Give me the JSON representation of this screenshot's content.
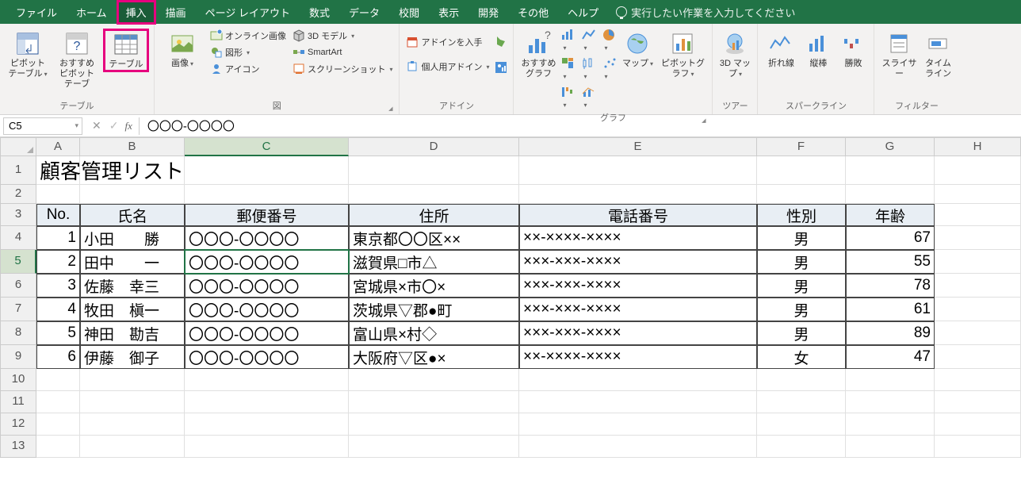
{
  "tabs": [
    "ファイル",
    "ホーム",
    "挿入",
    "描画",
    "ページ レイアウト",
    "数式",
    "データ",
    "校閲",
    "表示",
    "開発",
    "その他",
    "ヘルプ"
  ],
  "tellme": "実行したい作業を入力してください",
  "ribbon": {
    "g_tables": {
      "label": "テーブル",
      "pivot": "ピボット\nテーブル",
      "recpivot": "おすすめ\nピボットテーブ",
      "table": "テーブル"
    },
    "g_illust": {
      "label": "図",
      "image": "画像",
      "online": "オンライン画像",
      "shapes": "図形",
      "icons": "アイコン",
      "model": "3D モデル",
      "smartart": "SmartArt",
      "screenshot": "スクリーンショット"
    },
    "g_addins": {
      "label": "アドイン",
      "get": "アドインを入手",
      "my": "個人用アドイン"
    },
    "g_charts": {
      "label": "グラフ",
      "rec": "おすすめ\nグラフ",
      "map": "マップ",
      "pivotchart": "ピボットグラフ"
    },
    "g_tours": {
      "label": "ツアー",
      "map3d": "3D\nマップ"
    },
    "g_spark": {
      "label": "スパークライン",
      "line": "折れ線",
      "col": "縦棒",
      "winloss": "勝敗"
    },
    "g_filter": {
      "label": "フィルター",
      "slicer": "スライサー",
      "timeline": "タイム\nライン"
    }
  },
  "fbar": {
    "name": "C5",
    "formula": "〇〇〇-〇〇〇〇"
  },
  "cols": [
    "A",
    "B",
    "C",
    "D",
    "E",
    "F",
    "G",
    "H"
  ],
  "title": "顧客管理リスト",
  "headers": [
    "No.",
    "氏名",
    "郵便番号",
    "住所",
    "電話番号",
    "性別",
    "年齢"
  ],
  "data": [
    {
      "no": "1",
      "name": "小田　　勝",
      "zip": "〇〇〇-〇〇〇〇",
      "addr": "東京都〇〇区××",
      "tel": "××-××××-××××",
      "sex": "男",
      "age": "67"
    },
    {
      "no": "2",
      "name": "田中　　一",
      "zip": "〇〇〇-〇〇〇〇",
      "addr": "滋賀県□市△",
      "tel": "×××-×××-××××",
      "sex": "男",
      "age": "55"
    },
    {
      "no": "3",
      "name": "佐藤　幸三",
      "zip": "〇〇〇-〇〇〇〇",
      "addr": "宮城県×市〇×",
      "tel": "×××-×××-××××",
      "sex": "男",
      "age": "78"
    },
    {
      "no": "4",
      "name": "牧田　槇一",
      "zip": "〇〇〇-〇〇〇〇",
      "addr": "茨城県▽郡●町",
      "tel": "×××-×××-××××",
      "sex": "男",
      "age": "61"
    },
    {
      "no": "5",
      "name": "神田　勘吉",
      "zip": "〇〇〇-〇〇〇〇",
      "addr": "富山県×村◇",
      "tel": "×××-×××-××××",
      "sex": "男",
      "age": "89"
    },
    {
      "no": "6",
      "name": "伊藤　御子",
      "zip": "〇〇〇-〇〇〇〇",
      "addr": "大阪府▽区●×",
      "tel": "××-××××-××××",
      "sex": "女",
      "age": "47"
    }
  ]
}
